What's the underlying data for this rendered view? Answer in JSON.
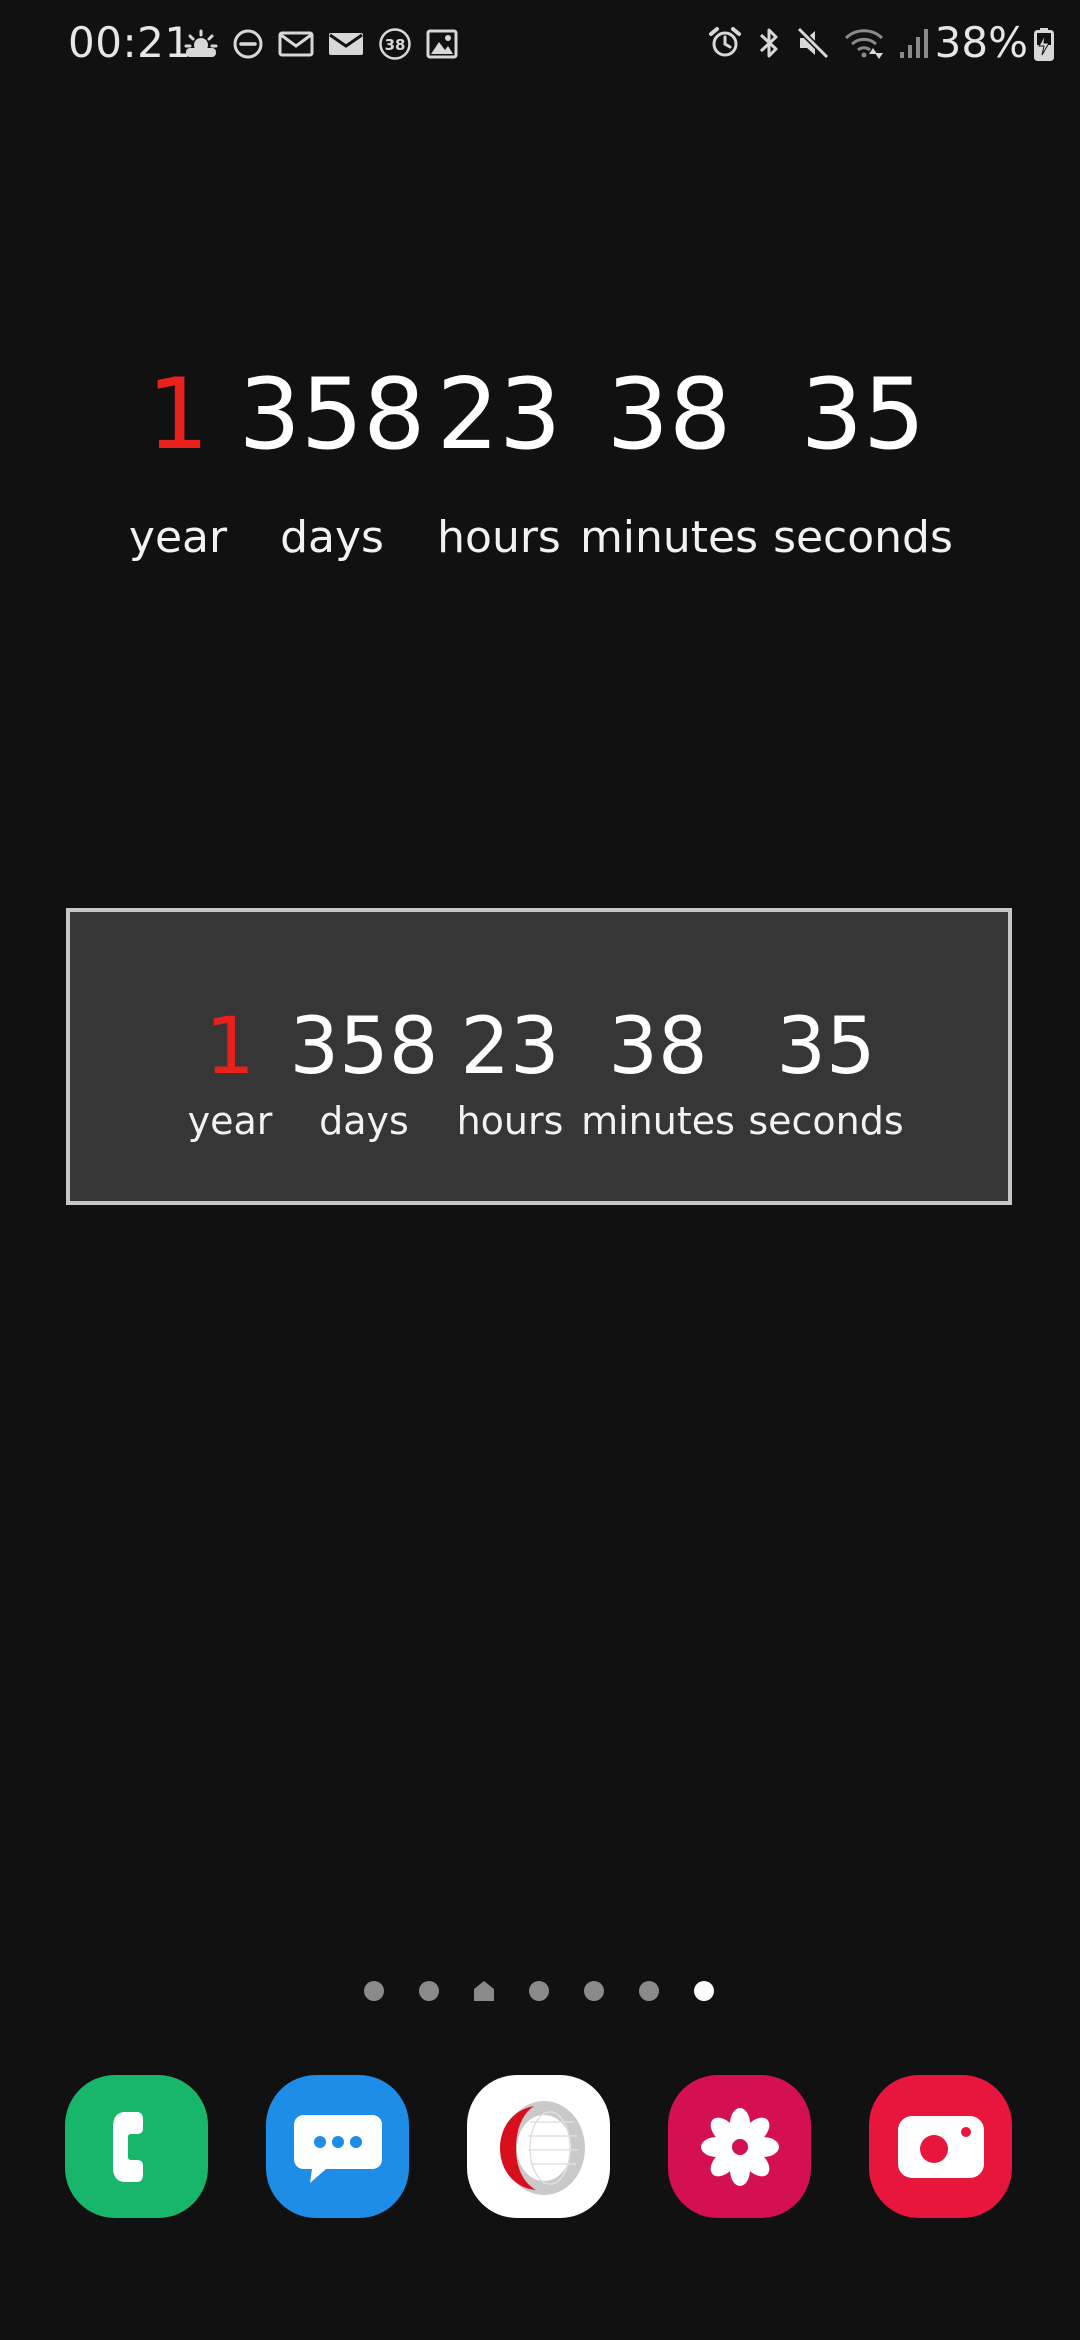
{
  "status_bar": {
    "time": "00:21",
    "battery": "38%",
    "left_icons": [
      "weather-icon",
      "dnd-icon",
      "email-icon",
      "email-alt-icon",
      "badge-38-icon",
      "image-icon"
    ],
    "badge_count": "38",
    "right_icons": [
      "alarm-icon",
      "bluetooth-icon",
      "mute-icon",
      "wifi-icon",
      "signal-icon"
    ]
  },
  "countdown_large": {
    "units": [
      {
        "value": "1",
        "label": "year",
        "accent": true
      },
      {
        "value": "358",
        "label": "days",
        "accent": false
      },
      {
        "value": "23",
        "label": "hours",
        "accent": false
      },
      {
        "value": "38",
        "label": "minutes",
        "accent": false
      },
      {
        "value": "35",
        "label": "seconds",
        "accent": false
      }
    ]
  },
  "countdown_boxed": {
    "units": [
      {
        "value": "1",
        "label": "year",
        "accent": true
      },
      {
        "value": "358",
        "label": "days",
        "accent": false
      },
      {
        "value": "23",
        "label": "hours",
        "accent": false
      },
      {
        "value": "38",
        "label": "minutes",
        "accent": false
      },
      {
        "value": "35",
        "label": "seconds",
        "accent": false
      }
    ]
  },
  "page_indicator": {
    "pages": 7,
    "home_index": 2,
    "active_index": 6
  },
  "dock": {
    "apps": [
      {
        "name": "phone-app-icon",
        "color": "#18b66a"
      },
      {
        "name": "messages-app-icon",
        "color": "#1d8de8"
      },
      {
        "name": "opera-browser-app-icon",
        "color": "#ffffff"
      },
      {
        "name": "gallery-app-icon",
        "color": "#d40f52"
      },
      {
        "name": "camera-app-icon",
        "color": "#e8163c"
      }
    ]
  },
  "colors": {
    "background": "#111112",
    "accent": "#e8211c",
    "widget_box": "#363636",
    "widget_border": "#c7c7c7"
  }
}
